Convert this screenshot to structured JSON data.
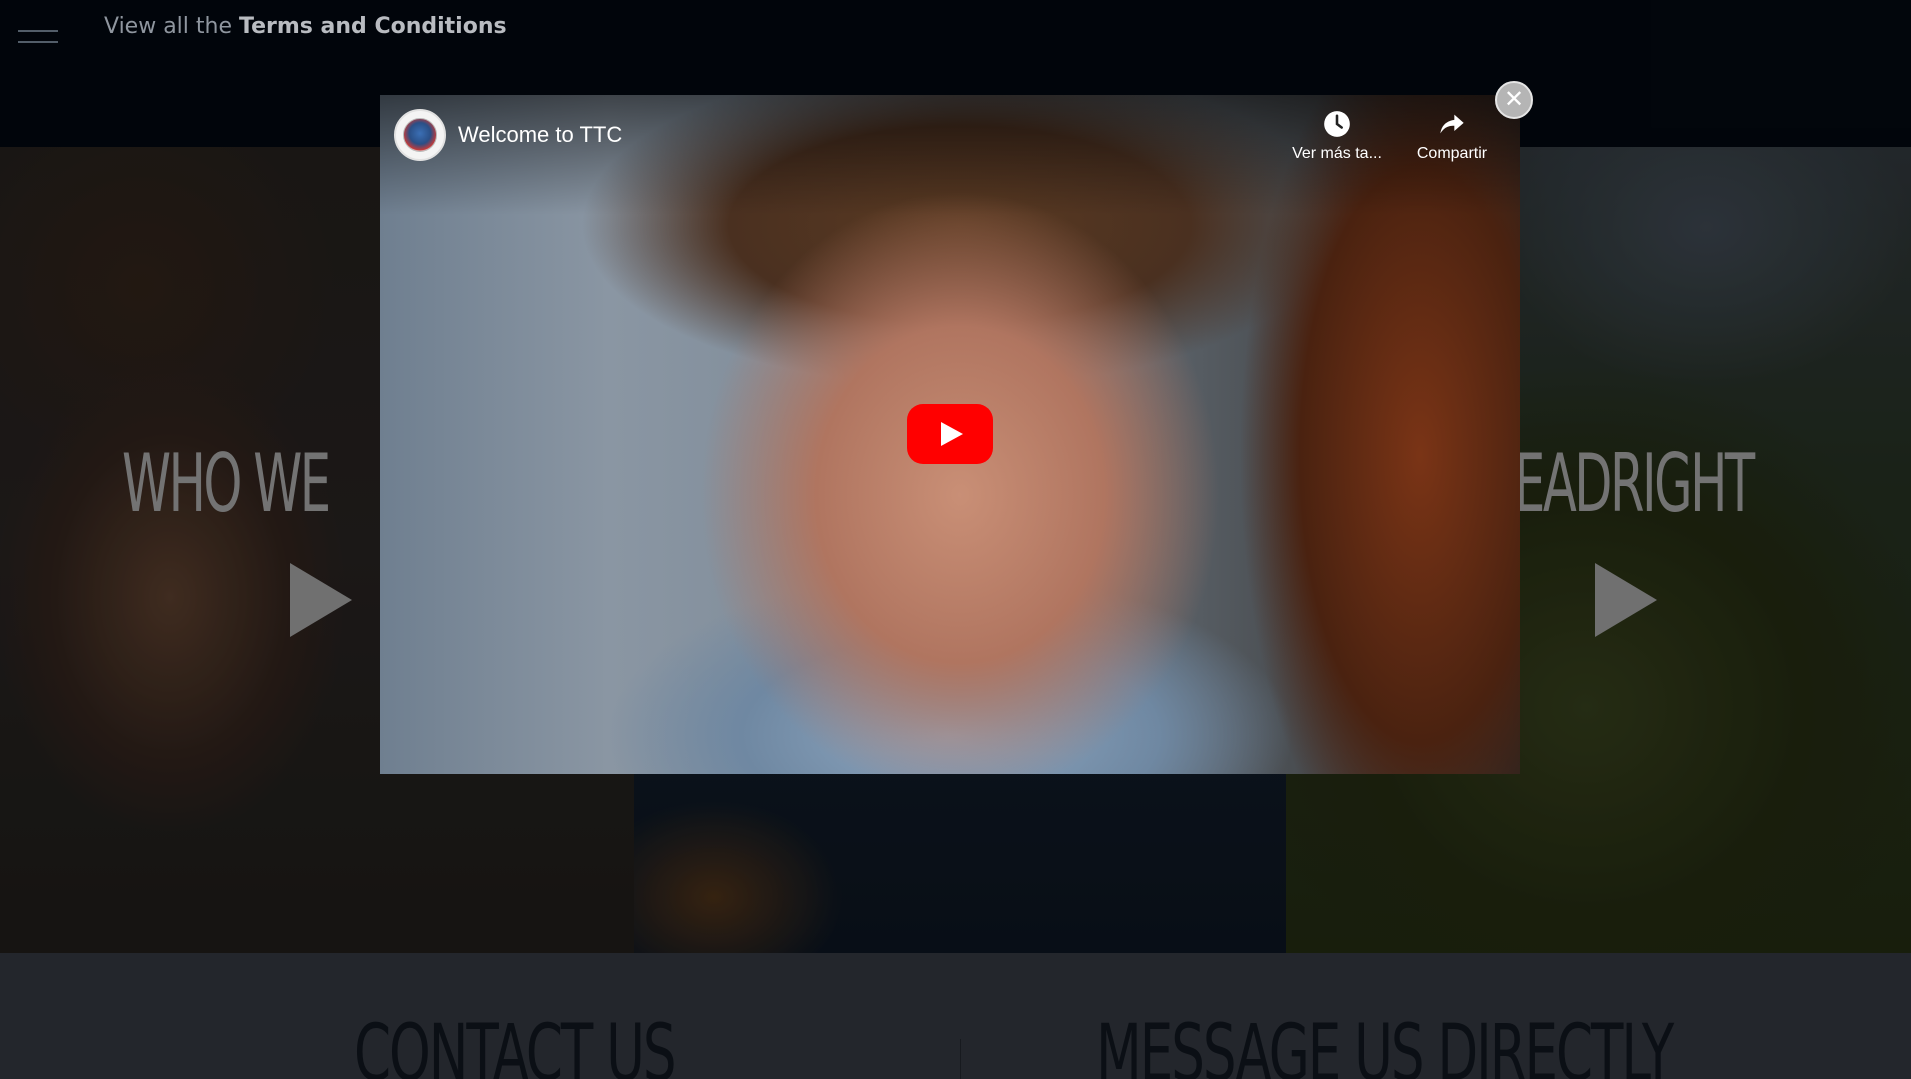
{
  "header": {
    "menu_icon": "hamburger-icon",
    "terms_prefix": "View all the ",
    "terms_link": "Terms and Conditions"
  },
  "panels": {
    "left_title": "WHO WE",
    "right_title": "EADRIGHT",
    "play_icon": "play-triangle-icon"
  },
  "bottom": {
    "contact_heading": "CONTACT US",
    "message_heading": "MESSAGE US DIRECTLY"
  },
  "modal": {
    "close_icon": "close-icon",
    "close_symbol": "✕",
    "video": {
      "title": "Welcome to TTC",
      "watch_later_label": "Ver más ta...",
      "watch_later_icon": "clock-icon",
      "share_label": "Compartir",
      "share_icon": "share-arrow-icon",
      "play_icon": "youtube-play-icon",
      "play_color": "#ff0000"
    }
  }
}
